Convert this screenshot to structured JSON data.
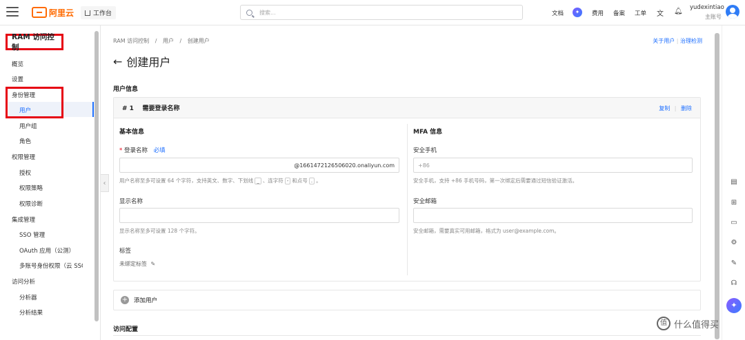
{
  "topbar": {
    "logo_text": "阿里云",
    "workspace": "工作台",
    "search_placeholder": "搜索...",
    "links": [
      "文档",
      "费用",
      "备案",
      "工单"
    ],
    "user_name": "yudexintiao",
    "user_role": "主账号"
  },
  "sidebar": {
    "title": "RAM 访问控制",
    "items": [
      {
        "label": "概览",
        "level": 0
      },
      {
        "label": "设置",
        "level": 0
      },
      {
        "label": "身份管理",
        "level": 0
      },
      {
        "label": "用户",
        "level": 1,
        "active": true
      },
      {
        "label": "用户组",
        "level": 1
      },
      {
        "label": "角色",
        "level": 1
      },
      {
        "label": "权限管理",
        "level": 0
      },
      {
        "label": "授权",
        "level": 1
      },
      {
        "label": "权限策略",
        "level": 1
      },
      {
        "label": "权限诊断",
        "level": 1
      },
      {
        "label": "集成管理",
        "level": 0
      },
      {
        "label": "SSO 管理",
        "level": 1
      },
      {
        "label": "OAuth 应用（公测）",
        "level": 1
      },
      {
        "label": "多账号身份权限（云 SSO",
        "level": 1
      },
      {
        "label": "访问分析",
        "level": 0
      },
      {
        "label": "分析器",
        "level": 1
      },
      {
        "label": "分析结果",
        "level": 1
      }
    ]
  },
  "breadcrumb": [
    "RAM 访问控制",
    "/",
    "用户",
    "/",
    "创建用户"
  ],
  "top_links": {
    "about": "关于用户",
    "govern": "治理检测",
    "sep": "|"
  },
  "page_title": "创建用户",
  "section_user_info": "用户信息",
  "card": {
    "header": "# 1    需要登录名称",
    "copy": "复制",
    "delete": "删除",
    "sep": "|",
    "basic_title": "基本信息",
    "login_label": "登录名称",
    "login_required": "必填",
    "login_suffix": "@1661472126506020.onaliyun.com",
    "login_hint_1": "用户名称至多可设置 64 个字符，支持英文、数字、下划线",
    "login_hint_kbd1": "_",
    "login_hint_2": "、连字符",
    "login_hint_kbd2": "-",
    "login_hint_3": "和点号",
    "login_hint_kbd3": ".",
    "login_hint_4": "。",
    "display_label": "显示名称",
    "display_hint": "显示名称至多可设置 128 个字符。",
    "tag_label": "标签",
    "tag_value": "未绑定标签",
    "mfa_title": "MFA 信息",
    "phone_label": "安全手机",
    "phone_placeholder": "+86",
    "phone_hint": "安全手机，支持 +86 手机号码，第一次绑定后需要通过短信验证激活。",
    "email_label": "安全邮箱",
    "email_hint": "安全邮箱，需要真实可用邮箱，格式为 user@example.com。"
  },
  "add_user": "添加用户",
  "section_access": "访问配置",
  "watermark": "什么值得买",
  "colors": {
    "accent": "#1e6fff",
    "brand": "#ff6a00",
    "highlight": "#e60012"
  }
}
